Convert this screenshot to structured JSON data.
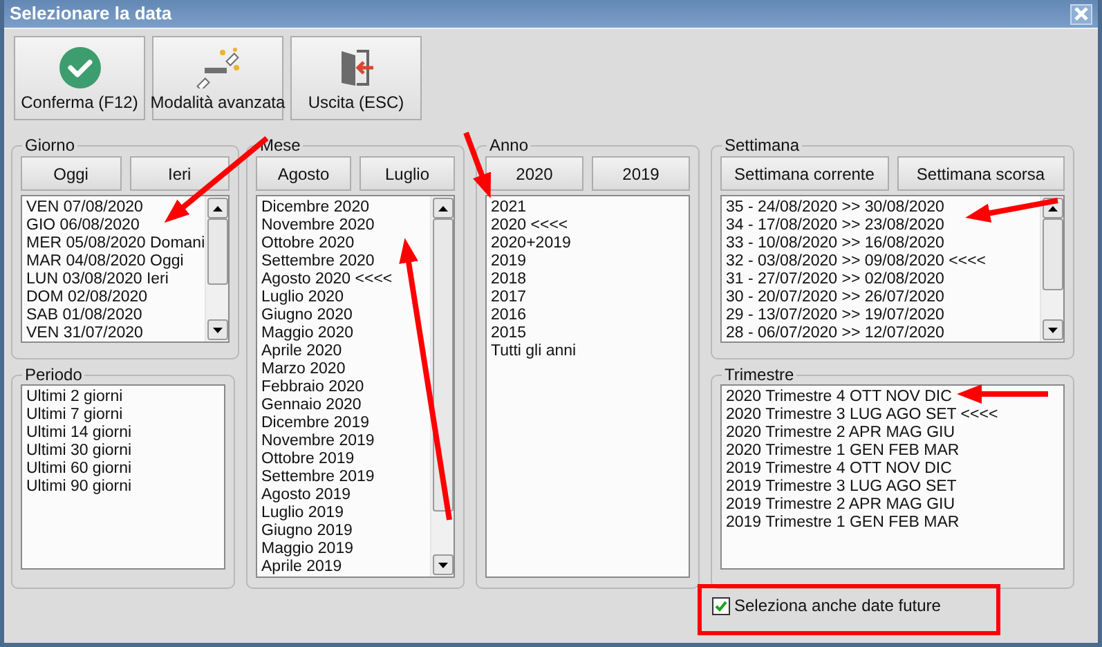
{
  "window": {
    "title": "Selezionare la data"
  },
  "toolbar": [
    {
      "label": "Conferma (F12)",
      "kind": "confirm"
    },
    {
      "label": "Modalità avanzata",
      "kind": "wand"
    },
    {
      "label": "Uscita (ESC)",
      "kind": "exit"
    }
  ],
  "giorno": {
    "title": "Giorno",
    "buttons": [
      "Oggi",
      "Ieri"
    ],
    "items": [
      "VEN 07/08/2020",
      "GIO 06/08/2020",
      "MER 05/08/2020 Domani",
      "MAR 04/08/2020 Oggi",
      "LUN 03/08/2020 Ieri",
      "DOM 02/08/2020",
      "SAB 01/08/2020",
      "VEN 31/07/2020"
    ]
  },
  "periodo": {
    "title": "Periodo",
    "items": [
      "Ultimi 2 giorni",
      "Ultimi 7 giorni",
      "Ultimi 14 giorni",
      "Ultimi 30 giorni",
      "Ultimi 60 giorni",
      "Ultimi 90 giorni"
    ]
  },
  "mese": {
    "title": "Mese",
    "buttons": [
      "Agosto",
      "Luglio"
    ],
    "items": [
      "Dicembre 2020",
      "Novembre 2020",
      "Ottobre 2020",
      "Settembre 2020",
      "Agosto 2020 <<<<",
      "Luglio 2020",
      "Giugno 2020",
      "Maggio 2020",
      "Aprile 2020",
      "Marzo 2020",
      "Febbraio 2020",
      "Gennaio 2020",
      "Dicembre 2019",
      "Novembre 2019",
      "Ottobre 2019",
      "Settembre 2019",
      "Agosto 2019",
      "Luglio 2019",
      "Giugno 2019",
      "Maggio 2019",
      "Aprile 2019"
    ]
  },
  "anno": {
    "title": "Anno",
    "buttons": [
      "2020",
      "2019"
    ],
    "items": [
      "2021",
      "2020 <<<<",
      "2020+2019",
      "2019",
      "2018",
      "2017",
      "2016",
      "2015",
      "Tutti gli anni"
    ]
  },
  "settimana": {
    "title": "Settimana",
    "buttons": [
      "Settimana corrente",
      "Settimana scorsa"
    ],
    "items": [
      "35 - 24/08/2020 >> 30/08/2020",
      "34 - 17/08/2020 >> 23/08/2020",
      "33 - 10/08/2020 >> 16/08/2020",
      "32 - 03/08/2020 >> 09/08/2020 <<<<",
      "31 - 27/07/2020 >> 02/08/2020",
      "30 - 20/07/2020 >> 26/07/2020",
      "29 - 13/07/2020 >> 19/07/2020",
      "28 - 06/07/2020 >> 12/07/2020"
    ]
  },
  "trimestre": {
    "title": "Trimestre",
    "items": [
      "2020 Trimestre 4 OTT NOV DIC",
      "2020 Trimestre 3 LUG AGO SET <<<<",
      "2020 Trimestre 2 APR MAG GIU",
      "2020 Trimestre 1 GEN FEB MAR",
      "2019 Trimestre 4 OTT NOV DIC",
      "2019 Trimestre 3 LUG AGO SET",
      "2019 Trimestre 2 APR MAG GIU",
      "2019 Trimestre 1 GEN FEB MAR"
    ]
  },
  "future_dates": {
    "label": "Seleziona anche date future",
    "checked": true
  }
}
